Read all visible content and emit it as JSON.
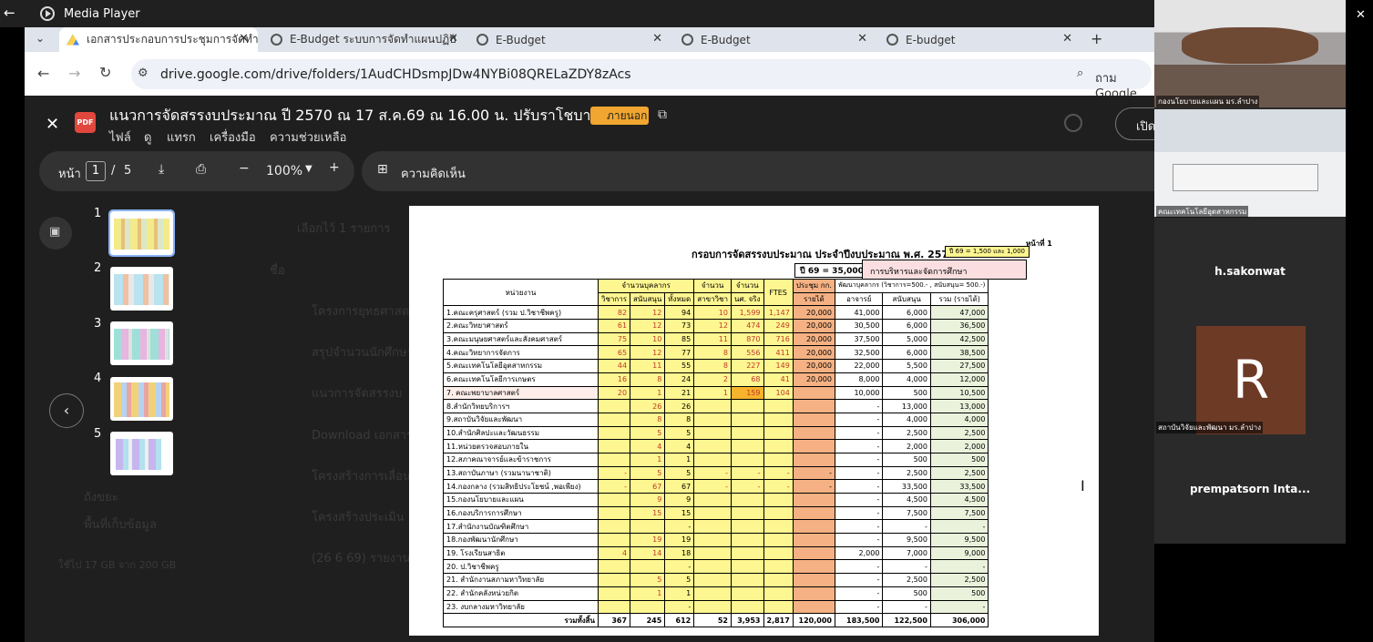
{
  "window": {
    "title": "Media Player",
    "minimize": "—",
    "restore": "⧉",
    "close": "✕"
  },
  "tabs": [
    {
      "label": "เอกสารประกอบการประชุมการจัดทำแ",
      "close": "✕"
    },
    {
      "label": "E-Budget ระบบการจัดทำแผนปฏิบั",
      "close": "✕"
    },
    {
      "label": "E-Budget",
      "close": "✕"
    },
    {
      "label": "E-Budget",
      "close": "✕"
    },
    {
      "label": "E-budget",
      "close": "✕"
    }
  ],
  "tabs_new": "+",
  "address": {
    "url": "drive.google.com/drive/folders/1AudCHDsmpJDw4NYBi08QRELaZDY8zAcs",
    "google_lens": "ถาม Google"
  },
  "viewer": {
    "title": "แนวการจัดสรรงบประมาณ ปี 2570 ณ 17 ส.ค.69 ณ 16.00 น. ปรับราโชบาย.pdf",
    "badge": "ภายนอก",
    "open_button": "เปิด",
    "menu": [
      "ไฟล์",
      "ดู",
      "แทรก",
      "เครื่องมือ",
      "ความช่วยเหลือ"
    ],
    "page_label": "หน้า",
    "page_current": "1",
    "page_sep": "/",
    "page_total": "5",
    "zoom": "100%",
    "comment_label": "ความคิดเห็น",
    "thumb_numbers": [
      "1",
      "2",
      "3",
      "4",
      "5"
    ],
    "background_list": [
      "เลือกไว้ 1 รายการ",
      "ชื่อ",
      "โครงการยุทธศาสตร์",
      "สรุปจำนวนนักศึกษา",
      "แนวการจัดสรรงบ",
      "Download เอกสาร",
      "โครงสร้างการเลื่อน",
      "โครงสร้างประเมิน",
      "(26 6 69) รายงาน",
      "ใช้ไป 17 GB จาก 200 GB",
      "ถังขยะ",
      "พื้นที่เก็บข้อมูล"
    ]
  },
  "sheet": {
    "page_no": "หน้าที่ 1",
    "title": "กรอบการจัดสรรงบประมาณ ประจำปีงบประมาณ พ.ศ. 2570",
    "note_box": "ปี 69 = 1,500 และ 1,000",
    "year_box": "ปี 69 = 35,000",
    "section": "การบริหารและจัดการศึกษา",
    "headers": {
      "unit": "หน่วยงาน",
      "staff": "จำนวนบุคลากร",
      "academic": "วิชาการ",
      "support": "สนับสนุน",
      "total": "ทั้งหมด",
      "programs_a": "จำนวน",
      "programs_b": "สาขาวิชา",
      "students_a": "จำนวน",
      "students_b": "นศ. จริง",
      "ftes": "FTES",
      "meeting_a": "ประชุม กก.",
      "meeting_b": "รายได้",
      "dev": "พัฒนาบุคลากร (วิชาการ=500.- , สนับสนุน= 500.-)",
      "lecturer": "อาจารย์",
      "support2": "สนับสนุน",
      "sum": "รวม (รายได้)"
    },
    "rows": [
      [
        "1.คณะครุศาสตร์ (รวม ป.วิชาชีพครู)",
        "82",
        "12",
        "94",
        "10",
        "1,599",
        "1,147",
        "20,000",
        "41,000",
        "6,000",
        "47,000"
      ],
      [
        "2.คณะวิทยาศาสตร์",
        "61",
        "12",
        "73",
        "12",
        "474",
        "249",
        "20,000",
        "30,500",
        "6,000",
        "36,500"
      ],
      [
        "3.คณะมนุษยศาสตร์และสังคมศาสตร์",
        "75",
        "10",
        "85",
        "11",
        "870",
        "716",
        "20,000",
        "37,500",
        "5,000",
        "42,500"
      ],
      [
        "4.คณะวิทยาการจัดการ",
        "65",
        "12",
        "77",
        "8",
        "556",
        "411",
        "20,000",
        "32,500",
        "6,000",
        "38,500"
      ],
      [
        "5.คณะเทคโนโลยีอุตสาหกรรม",
        "44",
        "11",
        "55",
        "8",
        "227",
        "149",
        "20,000",
        "22,000",
        "5,500",
        "27,500"
      ],
      [
        "6.คณะเทคโนโลยีการเกษตร",
        "16",
        "8",
        "24",
        "2",
        "68",
        "41",
        "20,000",
        "8,000",
        "4,000",
        "12,000"
      ],
      [
        "7. คณะพยาบาลศาสตร์",
        "20",
        "1",
        "21",
        "1",
        "159",
        "104",
        "",
        "10,000",
        "500",
        "10,500"
      ],
      [
        "8.สำนักวิทยบริการฯ",
        "",
        "26",
        "26",
        "",
        "",
        "",
        "",
        "-",
        "13,000",
        "13,000"
      ],
      [
        "9.สถาบันวิจัยและพัฒนา",
        "",
        "8",
        "8",
        "",
        "",
        "",
        "",
        "-",
        "4,000",
        "4,000"
      ],
      [
        "10.สำนักศิลปะและวัฒนธรรม",
        "",
        "5",
        "5",
        "",
        "",
        "",
        "",
        "-",
        "2,500",
        "2,500"
      ],
      [
        "11.หน่วยตรวจสอบภายใน",
        "",
        "4",
        "4",
        "",
        "",
        "",
        "",
        "-",
        "2,000",
        "2,000"
      ],
      [
        "12.สภาคณาจารย์และข้าราชการ",
        "",
        "1",
        "1",
        "",
        "",
        "",
        "",
        "-",
        "500",
        "500"
      ],
      [
        "13.สถาบันภาษา (รวมนานาชาติ)",
        "-",
        "5",
        "5",
        "-",
        "-",
        "-",
        "-",
        "-",
        "2,500",
        "2,500"
      ],
      [
        "14.กองกลาง (รวมสิทธิประโยชน์ ,พอเพียง)",
        "-",
        "67",
        "67",
        "-",
        "-",
        "-",
        "-",
        "-",
        "33,500",
        "33,500"
      ],
      [
        "15.กองนโยบายและแผน",
        "",
        "9",
        "9",
        "",
        "",
        "",
        "",
        "-",
        "4,500",
        "4,500"
      ],
      [
        "16.กองบริการการศึกษา",
        "",
        "15",
        "15",
        "",
        "",
        "",
        "",
        "-",
        "7,500",
        "7,500"
      ],
      [
        "17.สำนักงานบัณฑิตศึกษา",
        "",
        "",
        "-",
        "",
        "",
        "",
        "",
        "-",
        "-",
        "-"
      ],
      [
        "18.กองพัฒนานักศึกษา",
        "",
        "19",
        "19",
        "",
        "",
        "",
        "",
        "-",
        "9,500",
        "9,500"
      ],
      [
        "19. โรงเรียนสาธิต",
        "4",
        "14",
        "18",
        "",
        "",
        "",
        "",
        "2,000",
        "7,000",
        "9,000"
      ],
      [
        "20. ป.วิชาชีพครู",
        "",
        "",
        "-",
        "",
        "",
        "",
        "",
        "-",
        "-",
        "-"
      ],
      [
        "21. สำนักงานสภามหาวิทยาลัย",
        "",
        "5",
        "5",
        "",
        "",
        "",
        "",
        "-",
        "2,500",
        "2,500"
      ],
      [
        "22. สำนักคลังหน่วยกิต",
        "",
        "1",
        "1",
        "",
        "",
        "",
        "",
        "-",
        "500",
        "500"
      ],
      [
        "23. งบกลางมหาวิทยาลัย",
        "",
        "",
        "-",
        "",
        "",
        "",
        "",
        "-",
        "-",
        "-"
      ]
    ],
    "total": [
      "รวมทั้งสิ้น",
      "367",
      "245",
      "612",
      "52",
      "3,953",
      "2,817",
      "120,000",
      "183,500",
      "122,500",
      "306,000"
    ]
  },
  "participants": [
    {
      "name": "กองนโยบายและแผน มร.ลำปาง"
    },
    {
      "name": "คณะเทคโนโลยีอุตสาหกรรม"
    },
    {
      "name": "h.sakonwat"
    },
    {
      "name": "สถาบันวิจัยและพัฒนา มร.ลำปาง",
      "initial": "R"
    },
    {
      "name": "prempatsorn  Inta..."
    }
  ]
}
